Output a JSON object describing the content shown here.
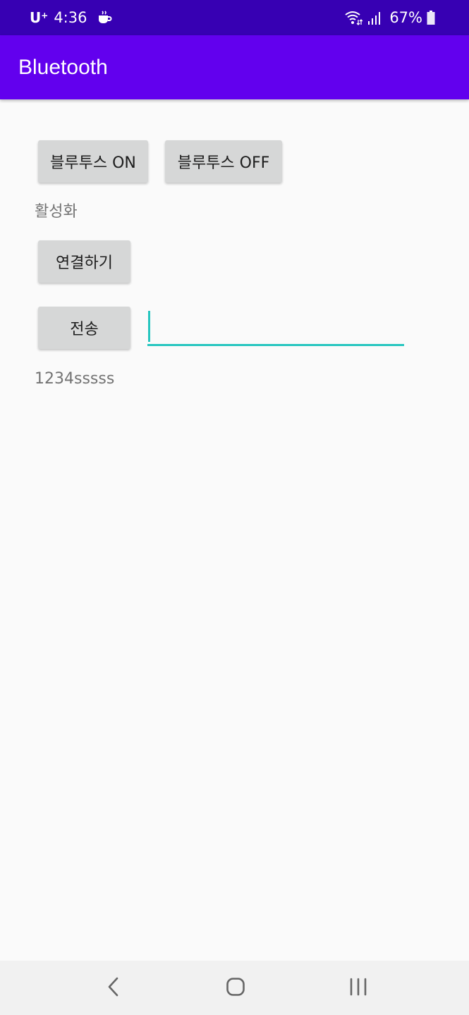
{
  "status_bar": {
    "carrier": "U",
    "carrier_sup": "+",
    "time": "4:36",
    "battery": "67%",
    "icons": [
      "coffee-icon",
      "wifi-icon",
      "signal-icon",
      "battery-icon"
    ]
  },
  "app_bar": {
    "title": "Bluetooth"
  },
  "buttons": {
    "on": "블루투스 ON",
    "off": "블루투스 OFF",
    "connect": "연결하기",
    "send": "전송"
  },
  "status_text": "활성화",
  "message_input": {
    "value": "",
    "placeholder": ""
  },
  "received_text": "1234sssss",
  "nav_bar": {
    "icons": [
      "back-icon",
      "home-icon",
      "recents-icon"
    ]
  },
  "colors": {
    "status_bar": "#3700b3",
    "app_bar": "#6200ee",
    "accent": "#26c6bf",
    "button": "#d6d7d7",
    "background": "#fafafa"
  }
}
